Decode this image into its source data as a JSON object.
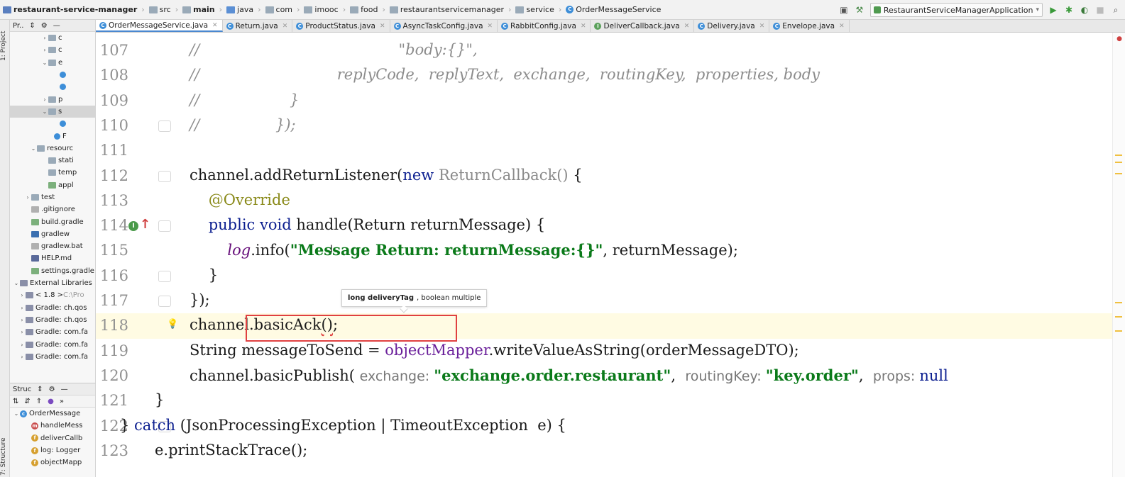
{
  "breadcrumbs": [
    {
      "label": "restaurant-service-manager",
      "icon": "module-icon",
      "bold": true
    },
    {
      "label": "src",
      "icon": "folder-icon"
    },
    {
      "label": "main",
      "icon": "folder-icon",
      "bold": true
    },
    {
      "label": "java",
      "icon": "source-folder-icon"
    },
    {
      "label": "com",
      "icon": "folder-icon"
    },
    {
      "label": "imooc",
      "icon": "folder-icon"
    },
    {
      "label": "food",
      "icon": "folder-icon"
    },
    {
      "label": "restaurantservicemanager",
      "icon": "folder-icon"
    },
    {
      "label": "service",
      "icon": "folder-icon"
    },
    {
      "label": "OrderMessageService",
      "icon": "class-icon"
    }
  ],
  "toolbar": {
    "run_config": "RestaurantServiceManagerApplication"
  },
  "left_strip": {
    "project_label": "1: Project",
    "structure_label": "7: Structure"
  },
  "project_panel": {
    "header": "Pr..",
    "rows": [
      {
        "indent": 5,
        "arrow": ">",
        "icon": "folder",
        "label": "c"
      },
      {
        "indent": 5,
        "arrow": ">",
        "icon": "folder",
        "label": "c"
      },
      {
        "indent": 5,
        "arrow": "v",
        "icon": "folder",
        "label": "e"
      },
      {
        "indent": 7,
        "arrow": "",
        "icon": "class",
        "label": ""
      },
      {
        "indent": 7,
        "arrow": "",
        "icon": "class",
        "label": ""
      },
      {
        "indent": 5,
        "arrow": ">",
        "icon": "folder",
        "label": "p"
      },
      {
        "indent": 5,
        "arrow": "v",
        "icon": "folder",
        "label": "s",
        "selected": true
      },
      {
        "indent": 7,
        "arrow": "",
        "icon": "class",
        "label": ""
      },
      {
        "indent": 6,
        "arrow": "",
        "icon": "class",
        "label": "F"
      },
      {
        "indent": 3,
        "arrow": "v",
        "icon": "folder",
        "label": "resourc"
      },
      {
        "indent": 5,
        "arrow": "",
        "icon": "folder",
        "label": "stati"
      },
      {
        "indent": 5,
        "arrow": "",
        "icon": "folder",
        "label": "temp"
      },
      {
        "indent": 5,
        "arrow": "",
        "icon": "gradle",
        "label": "appl"
      },
      {
        "indent": 2,
        "arrow": ">",
        "icon": "folder",
        "label": "test"
      },
      {
        "indent": 2,
        "arrow": "",
        "icon": "file",
        "label": ".gitignore"
      },
      {
        "indent": 2,
        "arrow": "",
        "icon": "gradle",
        "label": "build.gradle"
      },
      {
        "indent": 2,
        "arrow": "",
        "icon": "term",
        "label": "gradlew"
      },
      {
        "indent": 2,
        "arrow": "",
        "icon": "file",
        "label": "gradlew.bat"
      },
      {
        "indent": 2,
        "arrow": "",
        "icon": "md",
        "label": "HELP.md"
      },
      {
        "indent": 2,
        "arrow": "",
        "icon": "gradle",
        "label": "settings.gradle"
      },
      {
        "indent": 0,
        "arrow": "v",
        "icon": "lib",
        "label": "External Libraries"
      },
      {
        "indent": 1,
        "arrow": ">",
        "icon": "lib",
        "label": "< 1.8 >",
        "hint": "C:\\Pro"
      },
      {
        "indent": 1,
        "arrow": ">",
        "icon": "lib",
        "label": "Gradle: ch.qos"
      },
      {
        "indent": 1,
        "arrow": ">",
        "icon": "lib",
        "label": "Gradle: ch.qos"
      },
      {
        "indent": 1,
        "arrow": ">",
        "icon": "lib",
        "label": "Gradle: com.fa"
      },
      {
        "indent": 1,
        "arrow": ">",
        "icon": "lib",
        "label": "Gradle: com.fa"
      },
      {
        "indent": 1,
        "arrow": ">",
        "icon": "lib",
        "label": "Gradle: com.fa"
      }
    ]
  },
  "structure_panel": {
    "header": "Struc",
    "rows": [
      {
        "indent": 0,
        "arrow": "v",
        "icon": "c",
        "label": "OrderMessage"
      },
      {
        "indent": 2,
        "arrow": "",
        "icon": "m",
        "label": "handleMess"
      },
      {
        "indent": 2,
        "arrow": "",
        "icon": "f",
        "label": "deliverCallb"
      },
      {
        "indent": 2,
        "arrow": "",
        "icon": "f",
        "label": "log: Logger"
      },
      {
        "indent": 2,
        "arrow": "",
        "icon": "f",
        "label": "objectMapp"
      }
    ]
  },
  "tabs": [
    {
      "label": "OrderMessageService.java",
      "icon": "C",
      "active": true
    },
    {
      "label": "Return.java",
      "icon": "C"
    },
    {
      "label": "ProductStatus.java",
      "icon": "C"
    },
    {
      "label": "AsyncTaskConfig.java",
      "icon": "C"
    },
    {
      "label": "RabbitConfig.java",
      "icon": "C"
    },
    {
      "label": "DeliverCallback.java",
      "icon": "I"
    },
    {
      "label": "Delivery.java",
      "icon": "C"
    },
    {
      "label": "Envelope.java",
      "icon": "C"
    }
  ],
  "editor": {
    "tooltip": {
      "bold": "long deliveryTag",
      "rest": ", boolean multiple"
    },
    "lines": [
      {
        "n": "107",
        "segs": [
          [
            "cm",
            "//                                          \"body:{}\","
          ]
        ]
      },
      {
        "n": "108",
        "segs": [
          [
            "cm",
            "//                             replyCode,  replyText,  exchange,  routingKey,  properties, body"
          ]
        ]
      },
      {
        "n": "109",
        "segs": [
          [
            "cm",
            "//                   }"
          ]
        ]
      },
      {
        "n": "110",
        "fold": true,
        "segs": [
          [
            "cm",
            "//                });"
          ]
        ]
      },
      {
        "n": "111",
        "segs": []
      },
      {
        "n": "112",
        "fold": true,
        "segs": [
          [
            "",
            "channel.addReturnListener("
          ],
          [
            "kw",
            "new "
          ],
          [
            "cls",
            "ReturnCallback()"
          ],
          [
            "",
            " {"
          ]
        ]
      },
      {
        "n": "113",
        "segs": [
          [
            "ann",
            "    @Override"
          ]
        ]
      },
      {
        "n": "114",
        "impl": true,
        "fold": true,
        "segs": [
          [
            "kw",
            "    public void "
          ],
          [
            "",
            "handle(Return returnMessage) {"
          ]
        ]
      },
      {
        "n": "115",
        "segs": [
          [
            "",
            "        "
          ],
          [
            "fld",
            "log"
          ],
          [
            "",
            ".info("
          ],
          [
            "str",
            "\"Message Return: returnMessage:{}\""
          ],
          [
            "",
            ", returnMessage);"
          ]
        ]
      },
      {
        "n": "116",
        "fold": true,
        "segs": [
          [
            "",
            "    }"
          ]
        ]
      },
      {
        "n": "117",
        "fold": true,
        "segs": [
          [
            "",
            "});"
          ]
        ]
      },
      {
        "n": "118",
        "current": true,
        "bulb": true,
        "segs": [
          [
            "",
            "channel.basicAck"
          ],
          [
            "squig",
            "()"
          ],
          [
            "",
            ";"
          ]
        ]
      },
      {
        "n": "119",
        "segs": [
          [
            "",
            "String messageToSend = "
          ],
          [
            "purple",
            "objectMapper"
          ],
          [
            "",
            ".writeValueAsString(orderMessageDTO);"
          ]
        ]
      },
      {
        "n": "120",
        "segs": [
          [
            "",
            "channel.basicPublish( "
          ],
          [
            "hint",
            "exchange: "
          ],
          [
            "str",
            "\"exchange.order.restaurant\""
          ],
          [
            "",
            ",  "
          ],
          [
            "hint",
            "routingKey: "
          ],
          [
            "str",
            "\"key.order\""
          ],
          [
            "",
            ",  "
          ],
          [
            "hint",
            "props: "
          ],
          [
            "kw",
            "null"
          ]
        ]
      },
      {
        "n": "121",
        "segs": [
          [
            "",
            "}"
          ]
        ],
        "shift": -2
      },
      {
        "n": "122",
        "fold": true,
        "segs": [
          [
            "",
            "} "
          ],
          [
            "kw",
            "catch "
          ],
          [
            "",
            "(JsonProcessingException | TimeoutException  e) {"
          ]
        ],
        "shift": -4
      },
      {
        "n": "123",
        "segs": [
          [
            "",
            "e.printStackTrace();"
          ]
        ],
        "shift": -2
      }
    ]
  }
}
